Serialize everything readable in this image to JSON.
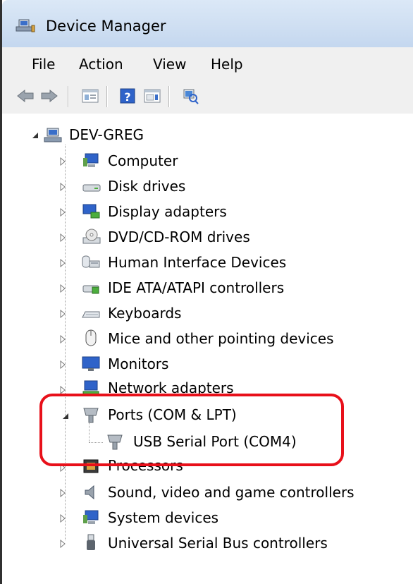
{
  "window": {
    "title": "Device Manager"
  },
  "menu": [
    "File",
    "Action",
    "View",
    "Help"
  ],
  "toolbar": {
    "icons": [
      "back-arrow-icon",
      "forward-arrow-icon",
      "show-hide-console-tree-icon",
      "help-icon",
      "properties-icon",
      "scan-hardware-icon"
    ]
  },
  "tree": {
    "root": "DEV-GREG",
    "categories": [
      {
        "label": "Computer",
        "icon": "computer-icon"
      },
      {
        "label": "Disk drives",
        "icon": "disk-drive-icon"
      },
      {
        "label": "Display adapters",
        "icon": "display-adapter-icon"
      },
      {
        "label": "DVD/CD-ROM drives",
        "icon": "dvd-drive-icon"
      },
      {
        "label": "Human Interface Devices",
        "icon": "hid-icon"
      },
      {
        "label": "IDE ATA/ATAPI controllers",
        "icon": "ide-controller-icon"
      },
      {
        "label": "Keyboards",
        "icon": "keyboard-icon"
      },
      {
        "label": "Mice and other pointing devices",
        "icon": "mouse-icon"
      },
      {
        "label": "Monitors",
        "icon": "monitor-icon"
      },
      {
        "label": "Network adapters",
        "icon": "network-adapter-icon"
      },
      {
        "label": "Ports (COM & LPT)",
        "icon": "port-icon",
        "expanded": true
      },
      {
        "label": "Processors",
        "icon": "processor-icon"
      },
      {
        "label": "Sound, video and game controllers",
        "icon": "speaker-icon"
      },
      {
        "label": "System devices",
        "icon": "system-devices-icon"
      },
      {
        "label": "Universal Serial Bus controllers",
        "icon": "usb-icon"
      }
    ],
    "port_child": {
      "label": "USB Serial Port (COM4)",
      "icon": "port-icon"
    }
  },
  "colors": {
    "highlight": "#e8101a",
    "titlebar": "#cfdff2",
    "toolbar": "#f0f0f0"
  }
}
